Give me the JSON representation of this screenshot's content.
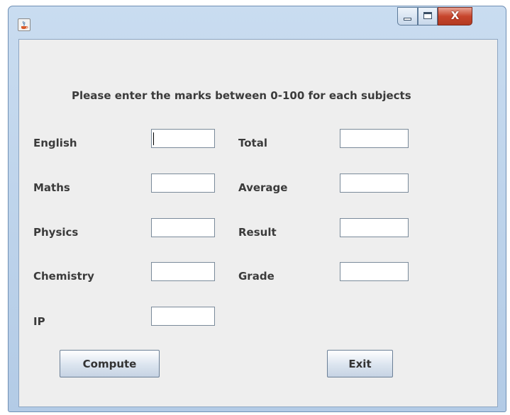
{
  "window": {
    "title": "",
    "controls": {
      "minimize": "minimize",
      "maximize": "maximize",
      "close": "X"
    }
  },
  "form": {
    "instruction": "Please enter the marks between 0-100 for each subjects",
    "subjects": [
      {
        "label": "English",
        "value": ""
      },
      {
        "label": "Maths",
        "value": ""
      },
      {
        "label": "Physics",
        "value": ""
      },
      {
        "label": "Chemistry",
        "value": ""
      },
      {
        "label": "IP",
        "value": ""
      }
    ],
    "results": [
      {
        "label": "Total",
        "value": ""
      },
      {
        "label": "Average",
        "value": ""
      },
      {
        "label": "Result",
        "value": ""
      },
      {
        "label": "Grade",
        "value": ""
      }
    ],
    "buttons": {
      "compute": "Compute",
      "exit": "Exit"
    }
  },
  "icons": {
    "app": "java-cup-icon",
    "minimize": "minimize-icon",
    "maximize": "maximize-icon",
    "close": "close-icon"
  },
  "colors": {
    "titlebar": "#c9dcf0",
    "client_bg": "#eeeeee",
    "close_button": "#c7452c",
    "label_text": "#3b3b3b"
  }
}
